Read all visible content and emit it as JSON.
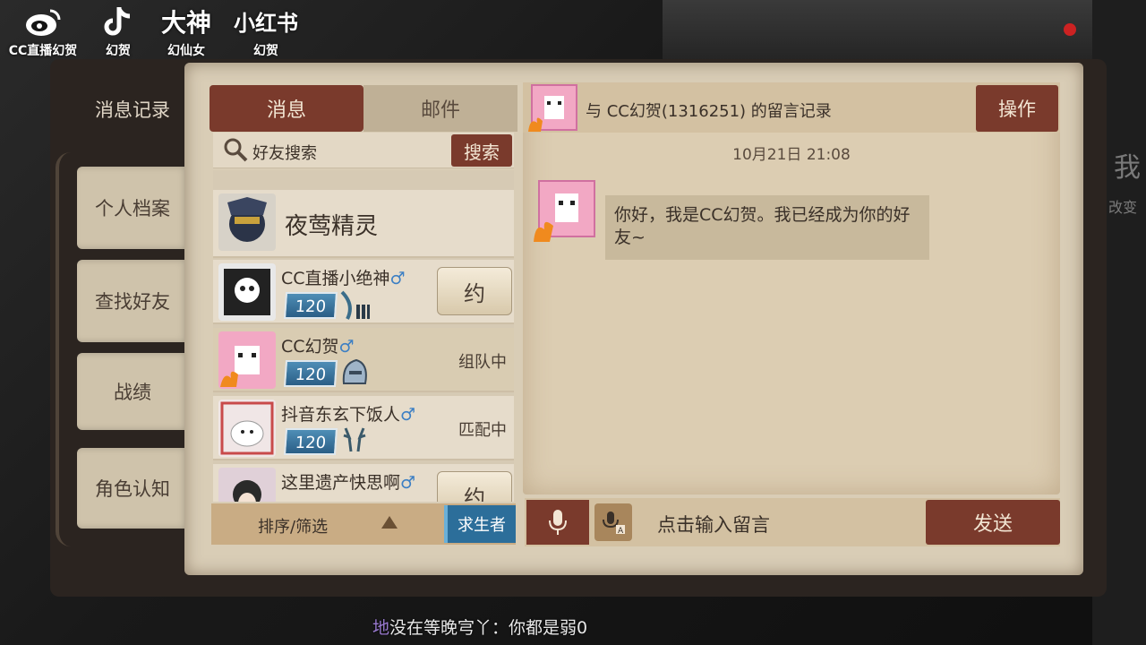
{
  "overlay": {
    "logos": [
      {
        "icon": "weibo-icon",
        "caption": "CC直播幻贺"
      },
      {
        "icon": "douyin-icon",
        "caption": "幻贺"
      },
      {
        "icon": "dashen-logo",
        "glyph": "大神",
        "caption": "幻仙女"
      },
      {
        "icon": "xiaohongshu-logo",
        "glyph": "小红书",
        "caption": "幻贺"
      }
    ],
    "danmaku_prefix": "地",
    "danmaku_text": "没在等晚宆丫：你都是弱0"
  },
  "background": {
    "right_glyph": "我",
    "right_text": "改变"
  },
  "sidebar": {
    "tabs": [
      {
        "label": "消息记录",
        "active": true
      },
      {
        "label": "个人档案"
      },
      {
        "label": "查找好友"
      },
      {
        "label": "战绩"
      },
      {
        "label": "角色认知"
      }
    ]
  },
  "friends": {
    "tabs": [
      "消息",
      "邮件"
    ],
    "search_placeholder": "好友搜索",
    "search_button": "搜索",
    "list": [
      {
        "name": "夜莺精灵"
      },
      {
        "name": "CC直播小绝神",
        "gender": "♂",
        "level": "120",
        "action": "约"
      },
      {
        "name": "CC幻贺",
        "gender": "♂",
        "level": "120",
        "status": "组队中"
      },
      {
        "name": "抖音东玄下饭人",
        "gender": "♂",
        "level": "120",
        "status": "匹配中"
      },
      {
        "name": "这里遗产快思啊",
        "gender": "♂",
        "action": "约"
      }
    ],
    "sort_label": "排序/筛选",
    "faction_button": "求生者"
  },
  "chat": {
    "title": "与 CC幻贺(1316251) 的留言记录",
    "op_button": "操作",
    "timestamp": "10月21日 21:08",
    "message": "你好，我是CC幻贺。我已经成为你的好友~",
    "input_placeholder": "点击输入留言",
    "send_button": "发送"
  },
  "colors": {
    "accent": "#7a3a2c",
    "paper": "#dccdb2",
    "level": "#2a5e86",
    "male": "#3c7fc4"
  }
}
